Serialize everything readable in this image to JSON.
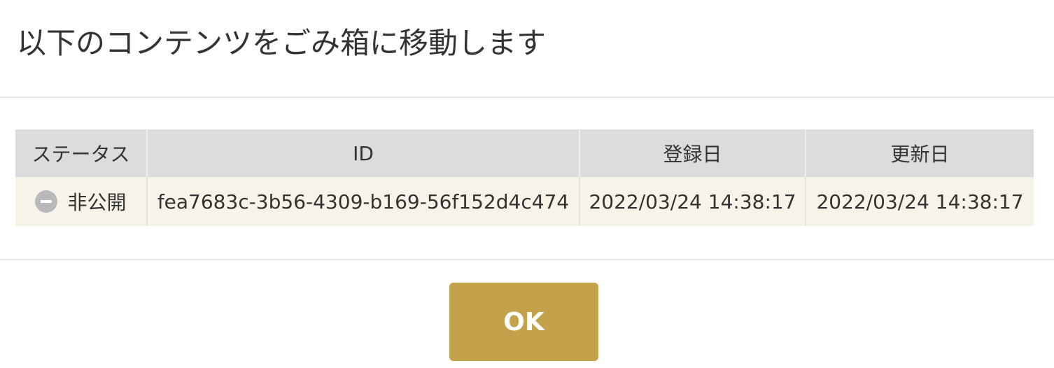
{
  "dialog": {
    "title": "以下のコンテンツをごみ箱に移動します"
  },
  "table": {
    "columns": [
      "ステータス",
      "ID",
      "登録日",
      "更新日"
    ],
    "rows": [
      {
        "status_icon": "minus-circle-icon",
        "status": "非公開",
        "id": "fea7683c-3b56-4309-b169-56f152d4c474",
        "created": "2022/03/24 14:38:17",
        "updated": "2022/03/24 14:38:17"
      }
    ]
  },
  "footer": {
    "ok_label": "OK"
  },
  "colors": {
    "accent": "#c4a24b",
    "header_bg": "#dcdcdc",
    "row_bg": "#f7f3e8"
  }
}
